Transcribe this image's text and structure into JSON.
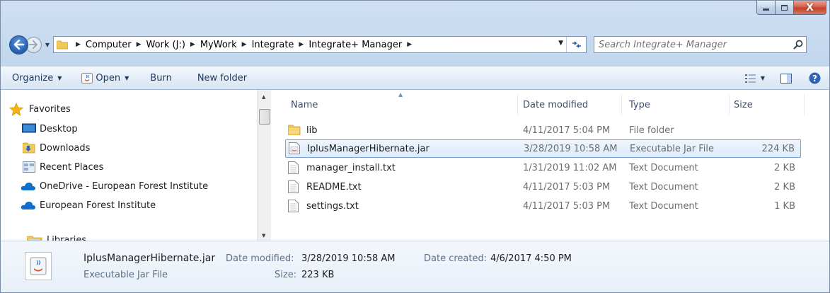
{
  "window": {
    "caption_min": "_",
    "caption_max": "□",
    "caption_close": "X"
  },
  "address": {
    "crumbs": [
      "Computer",
      "Work (J:)",
      "MyWork",
      "Integrate",
      "Integrate+ Manager"
    ]
  },
  "search": {
    "placeholder": "Search Integrate+ Manager"
  },
  "toolbar": {
    "organize": "Organize",
    "open": "Open",
    "burn": "Burn",
    "new_folder": "New folder"
  },
  "navpane": {
    "favorites": "Favorites",
    "items": [
      {
        "label": "Desktop",
        "icon": "desktop-icon"
      },
      {
        "label": "Downloads",
        "icon": "downloads-icon"
      },
      {
        "label": "Recent Places",
        "icon": "recent-places-icon"
      },
      {
        "label": "OneDrive - European Forest Institute",
        "icon": "cloud-icon"
      },
      {
        "label": "European Forest Institute",
        "icon": "cloud-icon"
      }
    ],
    "libraries": "Libraries"
  },
  "columns": {
    "name": "Name",
    "date": "Date modified",
    "type": "Type",
    "size": "Size"
  },
  "files": [
    {
      "name": "lib",
      "date": "4/11/2017 5:04 PM",
      "type": "File folder",
      "size": "",
      "icon": "folder-icon",
      "selected": false
    },
    {
      "name": "IplusManagerHibernate.jar",
      "date": "3/28/2019 10:58 AM",
      "type": "Executable Jar File",
      "size": "224 KB",
      "icon": "jar-file-icon",
      "selected": true
    },
    {
      "name": "manager_install.txt",
      "date": "1/31/2019 11:02 AM",
      "type": "Text Document",
      "size": "2 KB",
      "icon": "text-file-icon",
      "selected": false
    },
    {
      "name": "README.txt",
      "date": "4/11/2017 5:03 PM",
      "type": "Text Document",
      "size": "2 KB",
      "icon": "text-file-icon",
      "selected": false
    },
    {
      "name": "settings.txt",
      "date": "4/11/2017 5:03 PM",
      "type": "Text Document",
      "size": "1 KB",
      "icon": "text-file-icon",
      "selected": false
    }
  ],
  "details": {
    "filename": "IplusManagerHibernate.jar",
    "filetype": "Executable Jar File",
    "modified_label": "Date modified:",
    "modified_value": "3/28/2019 10:58 AM",
    "created_label": "Date created:",
    "created_value": "4/6/2017 4:50 PM",
    "size_label": "Size:",
    "size_value": "223 KB"
  },
  "colors": {
    "selection_border": "#7da2ce",
    "toolbar_text": "#1e395b",
    "folder_yellow": "#f1c95b"
  }
}
